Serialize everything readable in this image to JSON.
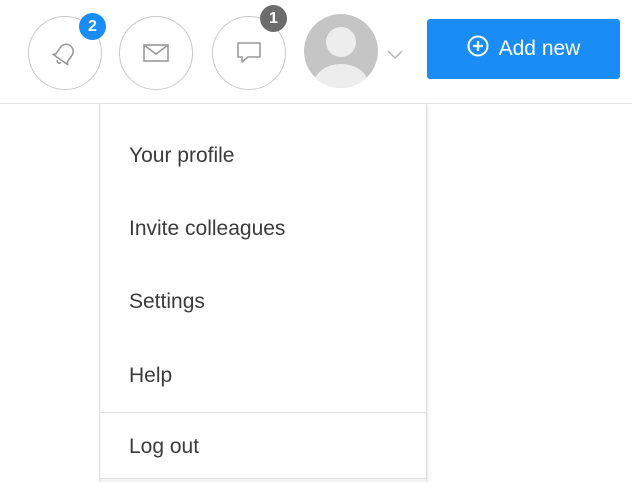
{
  "header": {
    "notifications": {
      "icon": "bell-icon",
      "badge": "2",
      "badge_color": "#1a8cf5"
    },
    "messages": {
      "icon": "envelope-icon"
    },
    "chat": {
      "icon": "chat-bubble-icon",
      "badge": "1",
      "badge_color": "#6c6c6c"
    },
    "profile": {
      "avatar_icon": "user-avatar-icon",
      "caret_icon": "chevron-down-icon"
    },
    "add_button": {
      "label": "Add new",
      "icon": "plus-circle-icon",
      "color": "#1a8cf5"
    }
  },
  "profile_menu": {
    "items": [
      {
        "label": "Your profile"
      },
      {
        "label": "Invite colleagues"
      },
      {
        "label": "Settings"
      },
      {
        "label": "Help"
      }
    ],
    "logout": {
      "label": "Log out"
    }
  }
}
